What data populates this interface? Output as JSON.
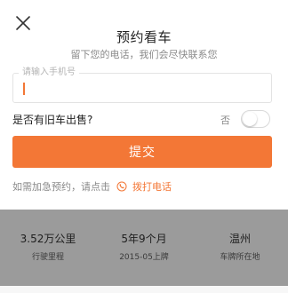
{
  "dialog": {
    "title": "预约看车",
    "subtitle": "留下您的电话，我们会尽快联系您",
    "close_icon": "close-icon"
  },
  "phone": {
    "placeholder": "请输入手机号",
    "value": ""
  },
  "trade_in": {
    "label": "是否有旧车出售?",
    "state_label": "否",
    "enabled": false
  },
  "submit_label": "提交",
  "urgent": {
    "text": "如需加急预约，请点击",
    "link_label": "拨打电话",
    "icon": "phone-icon"
  },
  "colors": {
    "accent": "#f37736",
    "overlay": "#9b9b9b"
  },
  "stats": [
    {
      "value": "3.52万公里",
      "caption": "行驶里程"
    },
    {
      "value": "5年9个月",
      "caption": "2015-05上牌"
    },
    {
      "value": "温州",
      "caption": "车牌所在地"
    }
  ]
}
